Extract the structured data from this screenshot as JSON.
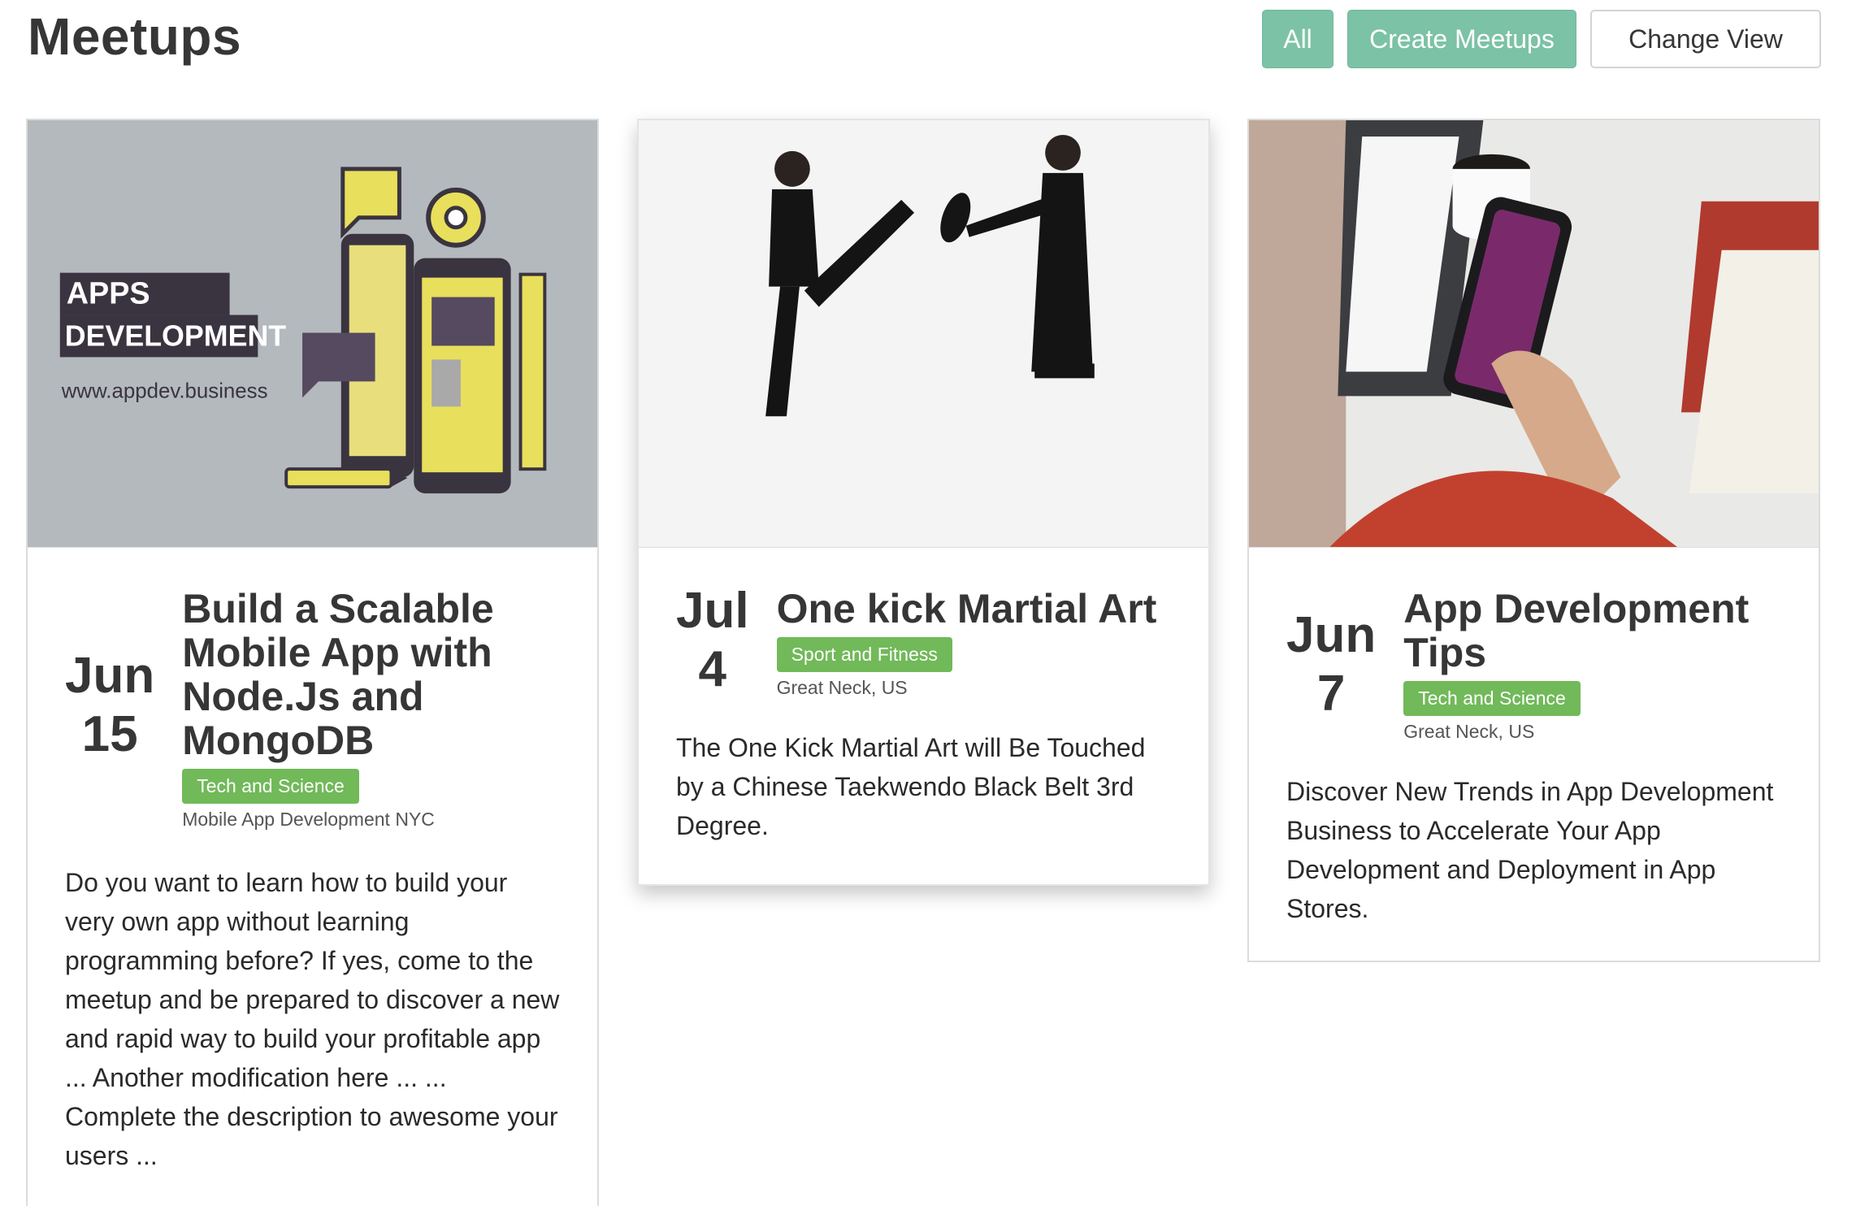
{
  "header": {
    "title": "Meetups"
  },
  "toolbar": {
    "all_label": "All",
    "create_label": "Create Meetups",
    "change_view_label": "Change View"
  },
  "colors": {
    "teal": "#7cc2a6",
    "tag_green": "#71b959",
    "text_dark": "#363636"
  },
  "cards": [
    {
      "image_text": {
        "line1": "APPS",
        "line2": "DEVELOPMENT",
        "url": "www.appdev.business"
      },
      "month": "Jun",
      "day": "15",
      "title": "Build a Scalable Mobile App with Node.Js and MongoDB",
      "tag": "Tech and Science",
      "location": "Mobile App Development NYC",
      "description": "Do you want to learn how to build your very own app without learning programming before? If yes, come to the meetup and be prepared to discover a new and rapid way to build your profitable app ... Another modification here ... ... Complete the description to awesome your users ..."
    },
    {
      "month": "Jul",
      "day": "4",
      "title": "One kick Martial Art",
      "tag": "Sport and Fitness",
      "location": "Great Neck, US",
      "description": "The One Kick Martial Art will Be Touched by a Chinese Taekwendo Black Belt 3rd Degree."
    },
    {
      "month": "Jun",
      "day": "7",
      "title": "App Development Tips",
      "tag": "Tech and Science",
      "location": "Great Neck, US",
      "description": "Discover New Trends in App Development Business to Accelerate Your App Development and Deployment in App Stores."
    }
  ]
}
